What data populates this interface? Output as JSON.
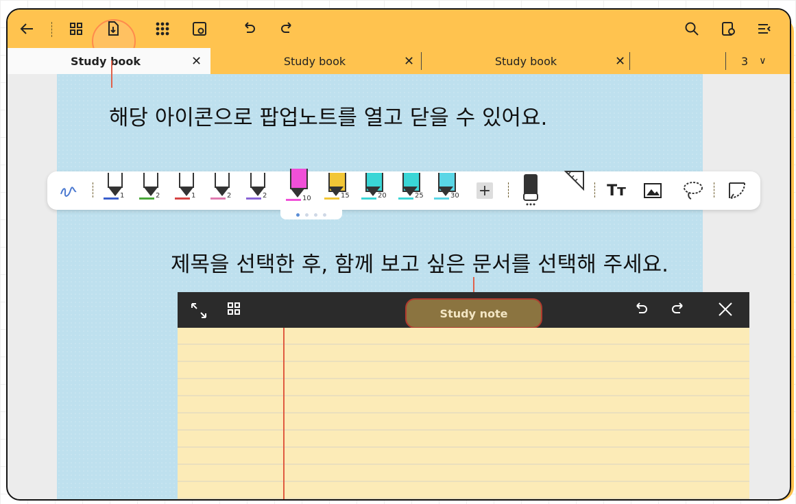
{
  "topbar": {
    "icons": [
      "back-arrow-icon",
      "grid-icon",
      "popup-note-icon",
      "apps-icon",
      "view-icon",
      "undo-icon",
      "redo-icon",
      "search-icon",
      "settings-icon",
      "menu-icon"
    ]
  },
  "tabs": [
    {
      "label": "Study book",
      "close": "✕",
      "active": true
    },
    {
      "label": "Study book",
      "close": "✕",
      "active": false
    },
    {
      "label": "Study book",
      "close": "✕",
      "active": false
    }
  ],
  "page_count": {
    "value": "3",
    "chevron": "∨"
  },
  "callouts": {
    "popup_toggle": "해당 아이콘으로 팝업노트를 열고 닫을 수 있어요.",
    "select_title": "제목을 선택한 후, 함께 보고 싶은 문서를 선택해 주세요."
  },
  "toolbar": {
    "pens": [
      {
        "num": "1",
        "color": "#3a5fcd"
      },
      {
        "num": "2",
        "color": "#4aa83a"
      },
      {
        "num": "1",
        "color": "#d64545"
      },
      {
        "num": "2",
        "color": "#e07ab0"
      },
      {
        "num": "2",
        "color": "#8a64d6"
      }
    ],
    "markers": [
      {
        "num": "10",
        "color": "#f050d8"
      },
      {
        "num": "15",
        "color": "#f2c636"
      },
      {
        "num": "20",
        "color": "#3ad6d6"
      },
      {
        "num": "25",
        "color": "#3ad6d6"
      },
      {
        "num": "30",
        "color": "#5ad6e6"
      }
    ],
    "add_label": "+",
    "text_label": "Tт"
  },
  "popup": {
    "title": "Study note",
    "colors": {
      "header": "#2b2b2b",
      "paper": "#FCEBB7",
      "title_bg": "#8B7440"
    }
  },
  "colors": {
    "accent": "#FFC34F",
    "canvas": "#BEE0EE"
  }
}
